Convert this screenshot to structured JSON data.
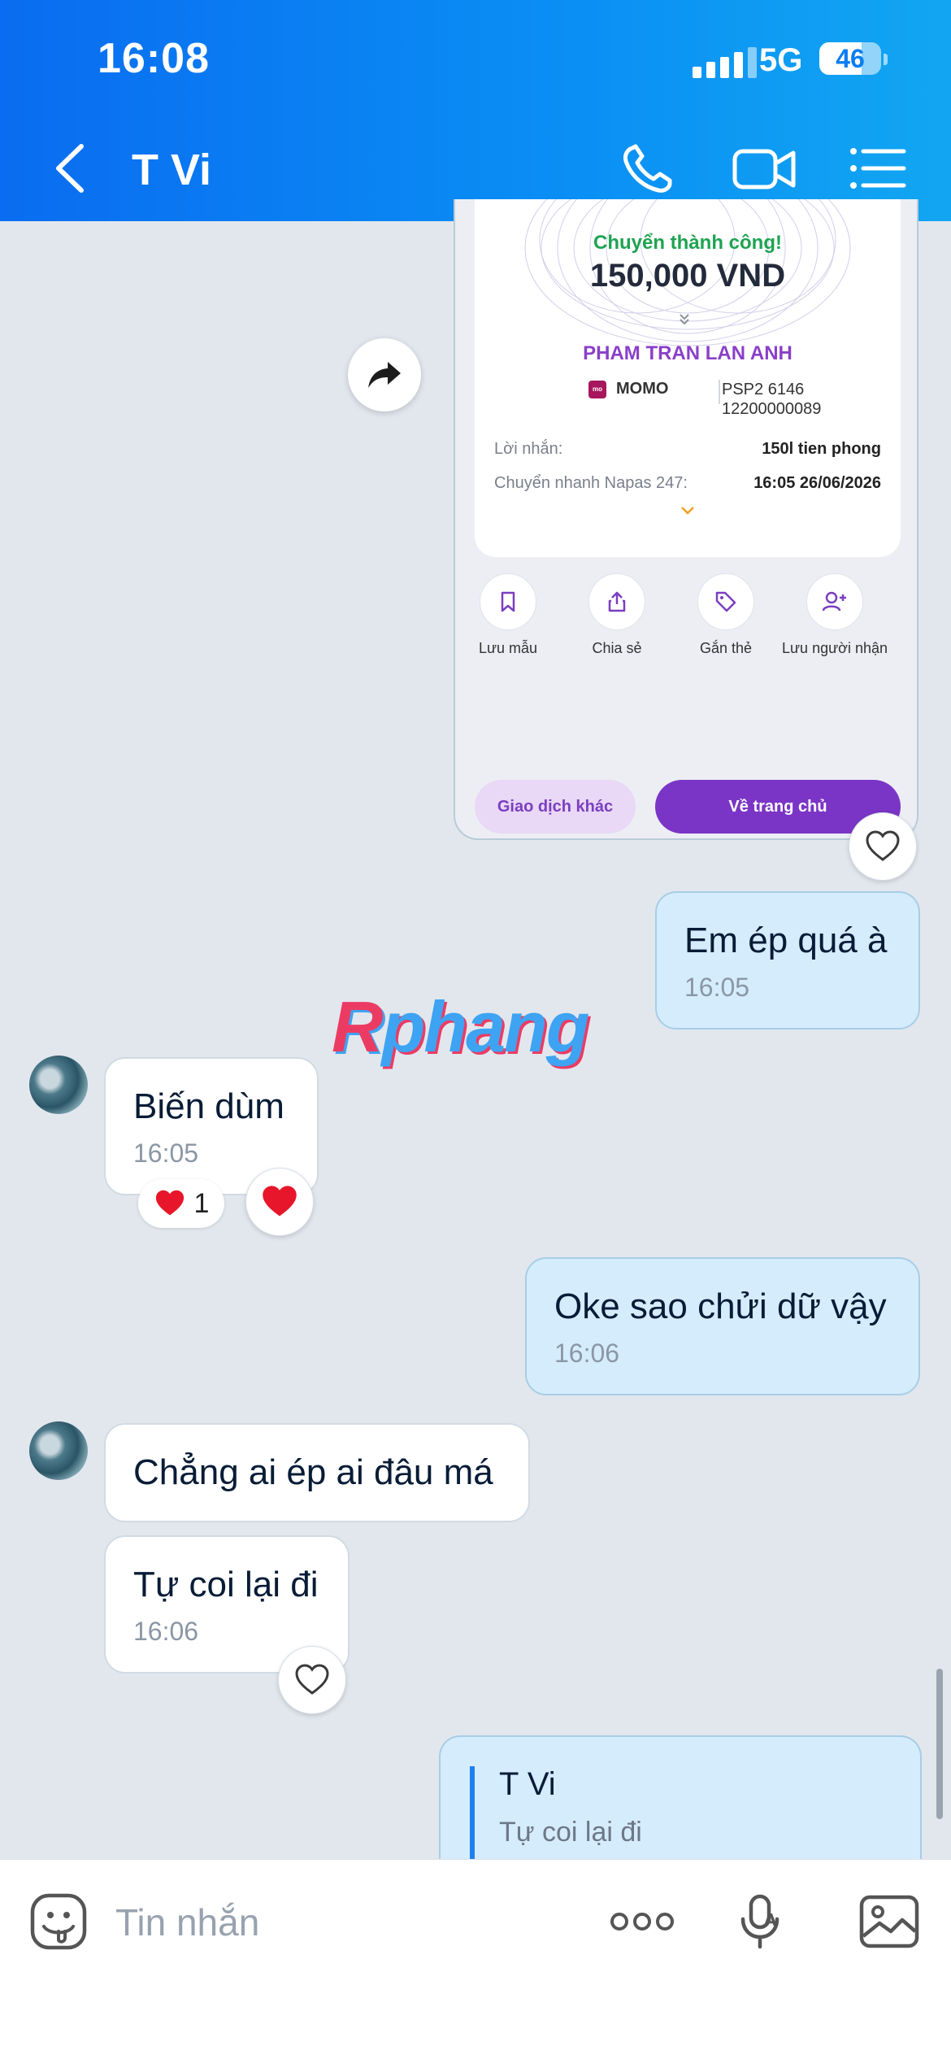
{
  "status_bar": {
    "time": "16:08",
    "network": "5G",
    "battery": "46"
  },
  "header": {
    "contact_name": "T Vi"
  },
  "transfer_card": {
    "status": "Chuyển thành công!",
    "amount": "150,000 VND",
    "recipient": "PHAM TRAN LAN ANH",
    "bank_name": "MOMO",
    "account_line1": "PSP2 6146",
    "account_line2": "12200000089",
    "message_label": "Lời nhắn:",
    "message_value": "150l tien phong",
    "transfer_label": "Chuyển nhanh Napas 247:",
    "transfer_value": "16:05 26/06/2026",
    "actions": [
      {
        "label": "Lưu mẫu",
        "icon": "bookmark-icon"
      },
      {
        "label": "Chia sẻ",
        "icon": "share-icon"
      },
      {
        "label": "Gắn thẻ",
        "icon": "tag-icon"
      },
      {
        "label": "Lưu người nhận",
        "icon": "add-person-icon"
      }
    ],
    "other_button": "Giao dịch khác",
    "home_button": "Về trang chủ"
  },
  "messages": [
    {
      "direction": "out",
      "text": "Em ép quá à",
      "time": "16:05"
    },
    {
      "direction": "in",
      "text": "Biến dùm",
      "time": "16:05",
      "reaction_count": "1"
    },
    {
      "direction": "out",
      "text": "Oke sao chửi dữ vậy",
      "time": "16:06"
    },
    {
      "direction": "in",
      "text": "Chẳng ai ép ai đâu má",
      "time": ""
    },
    {
      "direction": "in",
      "text": "Tự coi lại đi",
      "time": "16:06"
    }
  ],
  "quoted_reply": {
    "name": "T Vi",
    "text": "Tự coi lại đi"
  },
  "watermark": {
    "part1": "R",
    "part2": "phang"
  },
  "input": {
    "placeholder": "Tin nhắn"
  },
  "colors": {
    "header": "#0a8ff4",
    "out_bubble": "#d5ecfd",
    "in_bubble": "#ffffff",
    "momo_purple": "#7b35c6"
  }
}
